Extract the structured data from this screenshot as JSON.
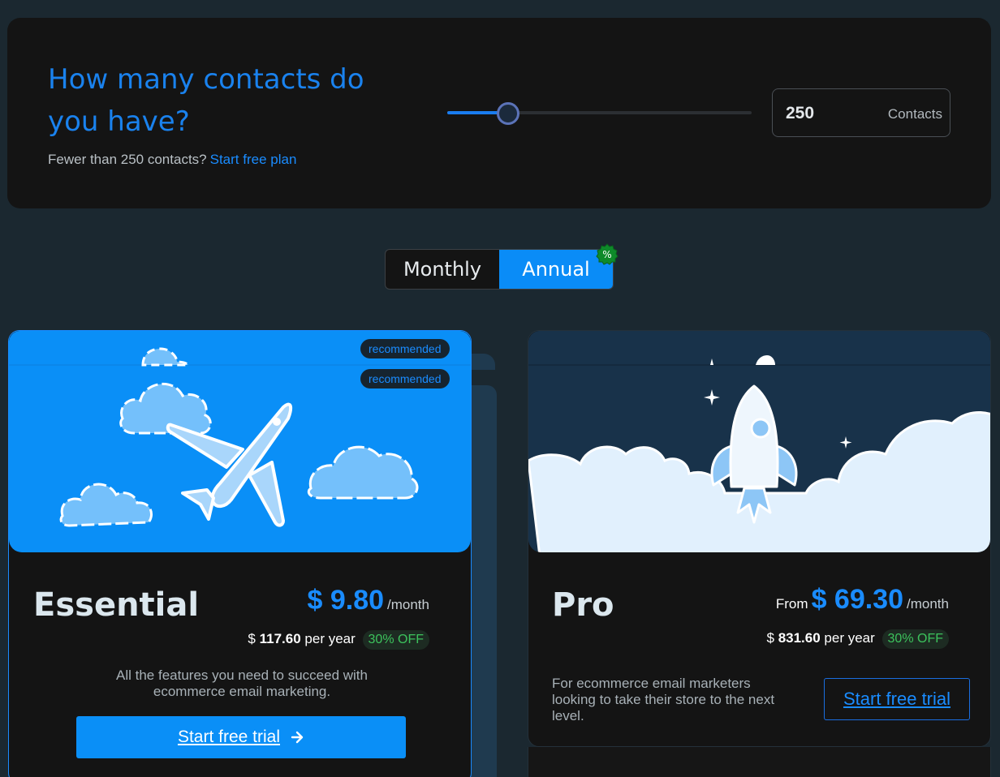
{
  "contacts": {
    "title": "How many contacts do you have?",
    "subtitle": "Fewer than 250 contacts?",
    "free_plan_link": "Start free plan",
    "slider_fraction": 0.2,
    "value": "250",
    "unit": "Contacts"
  },
  "billing": {
    "monthly_label": "Monthly",
    "annual_label": "Annual",
    "selected": "Annual",
    "discount_symbol": "%"
  },
  "plans": {
    "essential": {
      "badges": [
        "recommended",
        "recommended"
      ],
      "name": "Essential",
      "price": "$ 9.80",
      "per_month": "/month",
      "year_currency": "$",
      "year_amount": "117.60",
      "year_suffix": "per year",
      "discount": "30% OFF",
      "description": "All the features you need to succeed with ecommerce email marketing.",
      "cta": "Start free trial",
      "cta_icon": "arrow-right-icon"
    },
    "pro": {
      "from_label": "From",
      "name": "Pro",
      "price": "$ 69.30",
      "per_month": "/month",
      "year_currency": "$",
      "year_amount": "831.60",
      "year_suffix": "per year",
      "discount": "30% OFF",
      "description": "For ecommerce email marketers looking to take their store to the next level.",
      "cta": "Start free trial"
    }
  },
  "colors": {
    "page_bg": "#1b2830",
    "panel_bg": "#141414",
    "accent": "#1a8cff",
    "discount_green": "#3cc25c"
  }
}
